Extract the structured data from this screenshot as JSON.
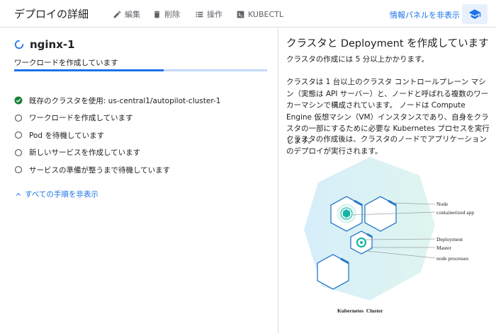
{
  "header": {
    "title": "デプロイの詳細",
    "edit_label": "編集",
    "delete_label": "削除",
    "operations_label": "操作",
    "kubectl_label": "KUBECTL",
    "info_panel_link": "情報パネルを非表示"
  },
  "workload": {
    "name": "nginx-1",
    "status": "ワークロードを作成しています",
    "progress_percent": 59
  },
  "steps": [
    {
      "state": "done",
      "label": "既存のクラスタを使用: us-central1/autopilot-cluster-1"
    },
    {
      "state": "pending",
      "label": "ワークロードを作成しています"
    },
    {
      "state": "pending",
      "label": "Pod を待機しています"
    },
    {
      "state": "pending",
      "label": "新しいサービスを作成しています"
    },
    {
      "state": "pending",
      "label": "サービスの準備が整うまで待機しています"
    }
  ],
  "hide_steps_label": "すべての手順を非表示",
  "info_panel": {
    "title": "クラスタと Deployment を作成しています",
    "p1": "クラスタの作成には 5 分以上かかります。",
    "p2": "クラスタは 1 台以上のクラスタ コントロールプレーン マシン（実態は API サーバー）と、ノードと呼ばれる複数のワーカーマシンで構成されています。 ノードは Compute Engine 仮想マシン（VM）インスタンスであり、自身をクラスタの一部にするために必要な Kubernetes プロセスを実行します。",
    "p3": "クラスタの作成後は、クラスタのノードでアプリケーションのデプロイが実行されます。"
  },
  "diagram": {
    "label_node": "Node",
    "label_containerized_app": "containerized app",
    "label_deployment": "Deployment",
    "label_master": "Master",
    "label_node_processes": "node processes",
    "label_cluster": "Kubernetes  Cluster"
  },
  "colors": {
    "accent": "#1a73e8",
    "success": "#188038",
    "teal": "#13b5a5"
  }
}
